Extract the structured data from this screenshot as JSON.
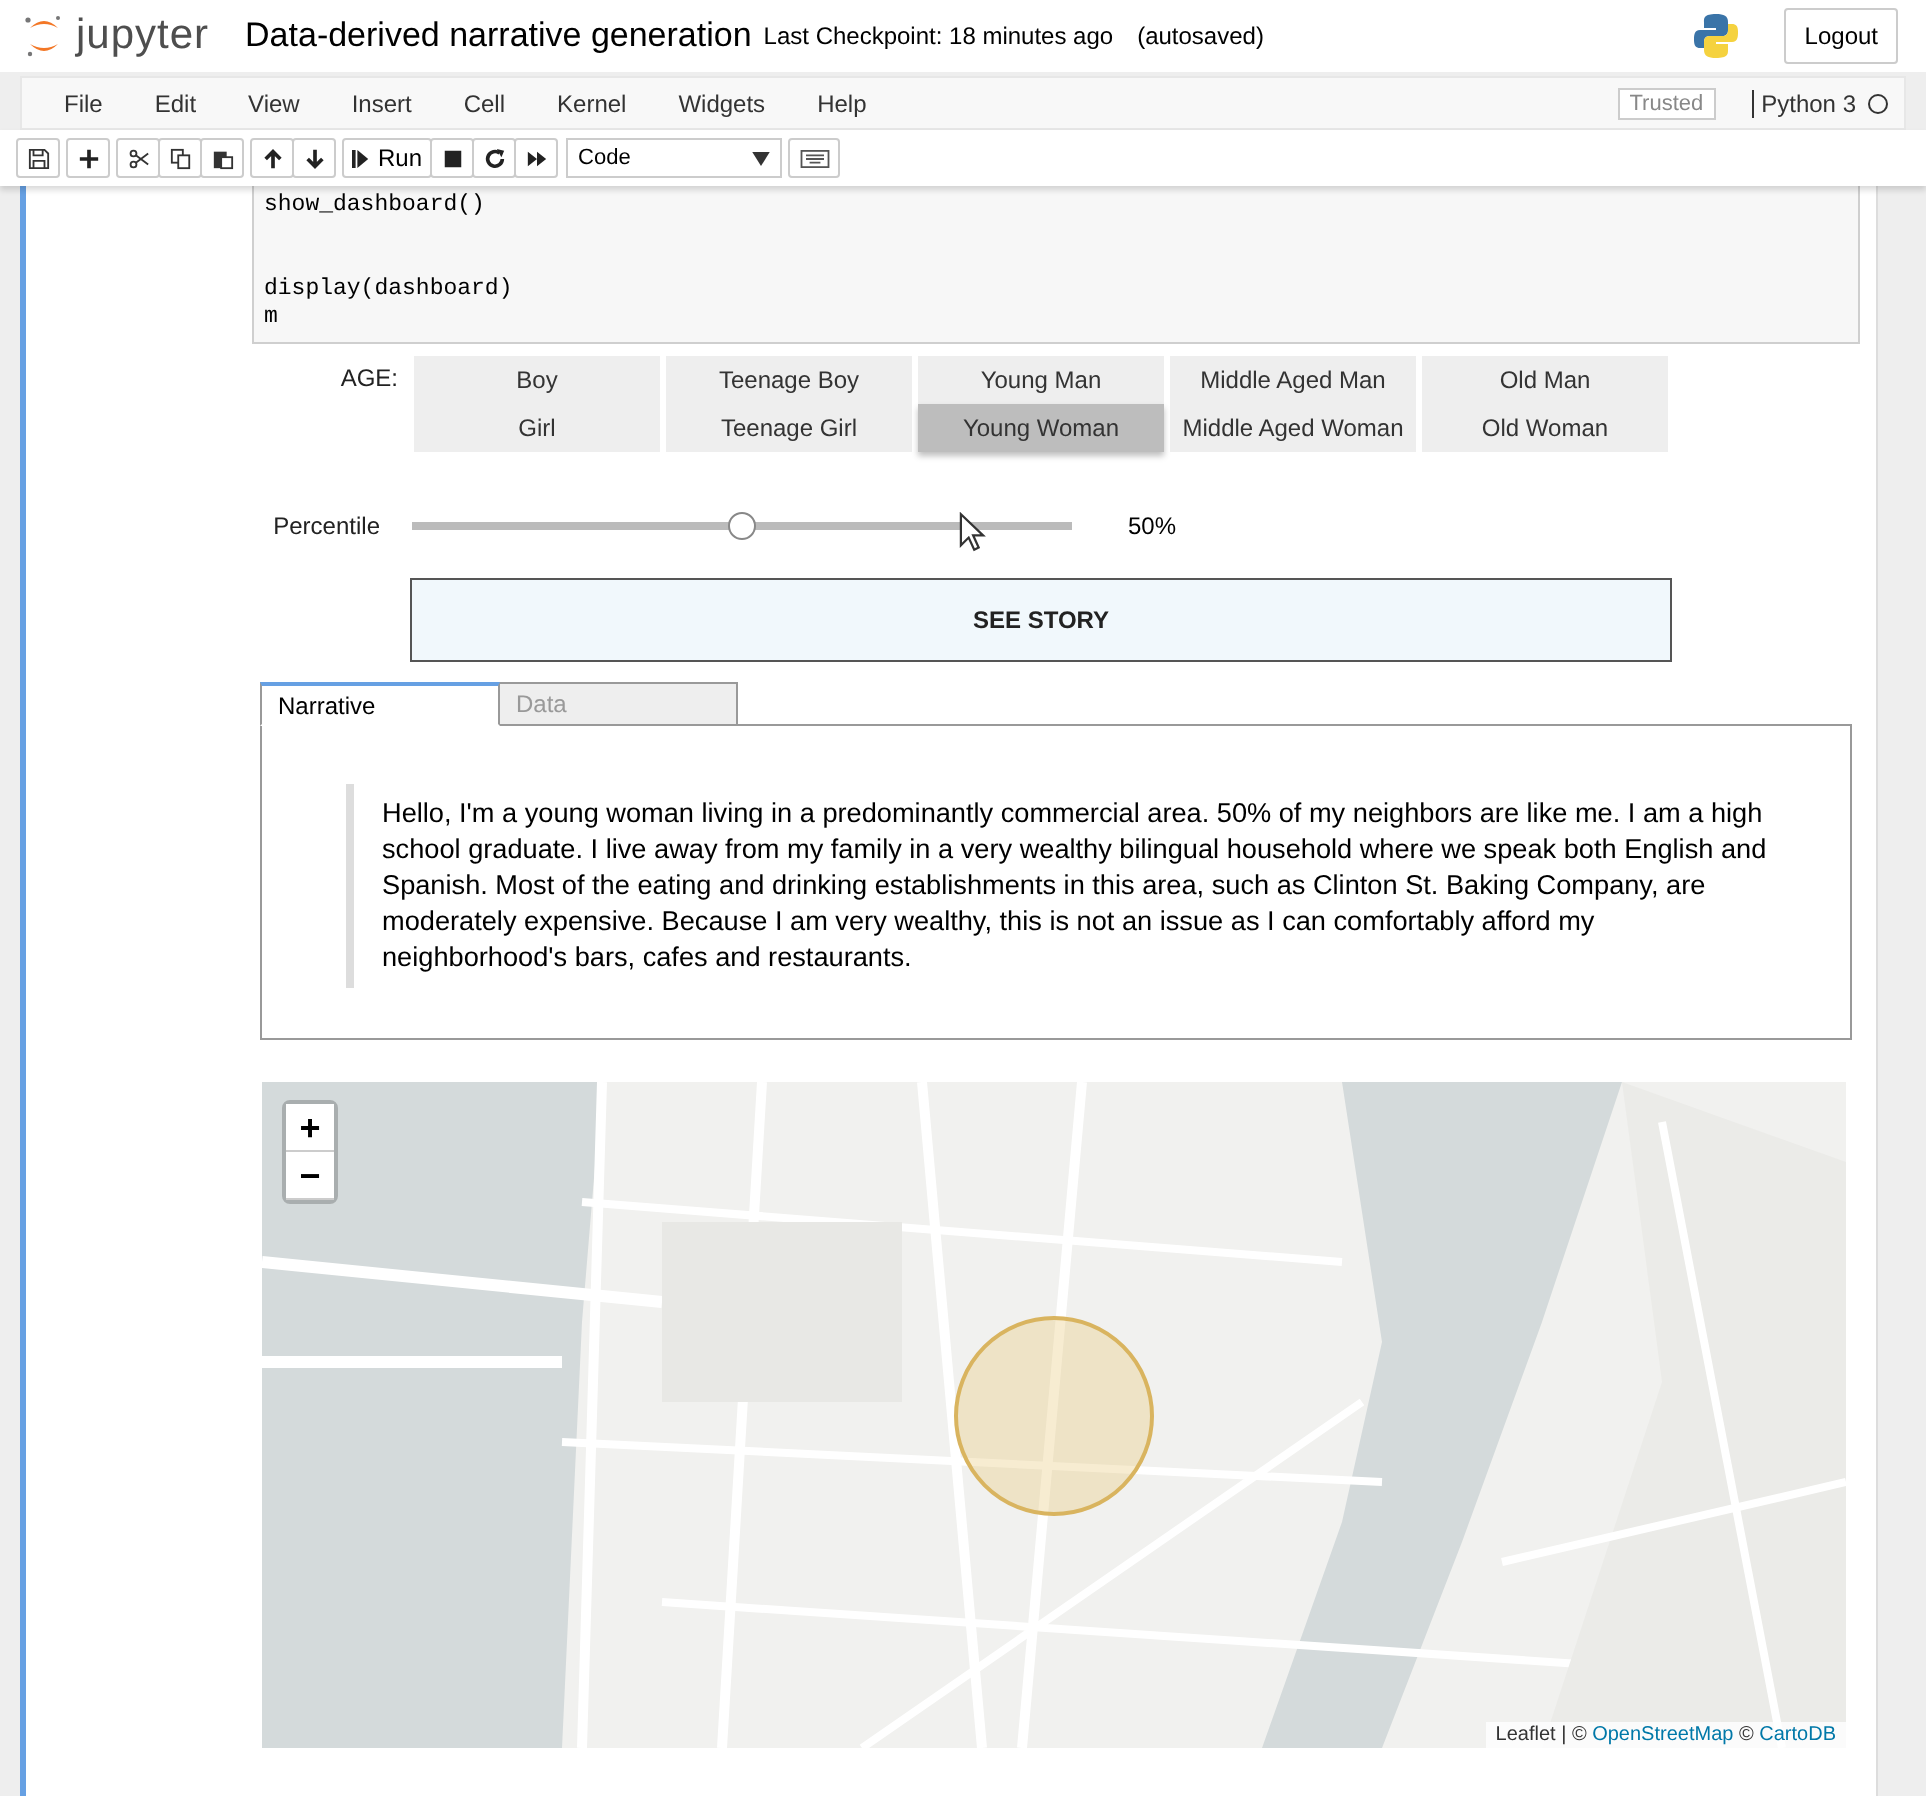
{
  "header": {
    "logo_text": "jupyter",
    "notebook_title": "Data-derived narrative generation",
    "checkpoint": "Last Checkpoint: 18 minutes ago",
    "autosave": "(autosaved)",
    "logout": "Logout"
  },
  "menu": {
    "items": [
      "File",
      "Edit",
      "View",
      "Insert",
      "Cell",
      "Kernel",
      "Widgets",
      "Help"
    ],
    "trusted": "Trusted",
    "kernel": "Python 3"
  },
  "toolbar": {
    "run": "Run",
    "cell_type": "Code"
  },
  "code": [
    {
      "lines": [
        "show_dashboard()"
      ]
    },
    {
      "lines": [
        "display(dashboard)",
        "m"
      ]
    }
  ],
  "age": {
    "label": "AGE:",
    "options": [
      {
        "label": "Boy",
        "selected": false
      },
      {
        "label": "Teenage Boy",
        "selected": false
      },
      {
        "label": "Young Man",
        "selected": false
      },
      {
        "label": "Middle Aged Man",
        "selected": false
      },
      {
        "label": "Old Man",
        "selected": false
      },
      {
        "label": "Girl",
        "selected": false
      },
      {
        "label": "Teenage Girl",
        "selected": false
      },
      {
        "label": "Young Woman",
        "selected": true
      },
      {
        "label": "Middle Aged Woman",
        "selected": false
      },
      {
        "label": "Old Woman",
        "selected": false
      }
    ]
  },
  "slider": {
    "label": "Percentile",
    "level": 0.5,
    "reading": "50%"
  },
  "story_button": "SEE STORY",
  "tabs": [
    {
      "label": "Narrative",
      "selected": true
    },
    {
      "label": "Data",
      "selected": false
    }
  ],
  "narrative": "Hello, I'm a young woman living in a predominantly commercial area. 50% of my neighbors are like me. I am a high school graduate. I live away from my family in a very wealthy bilingual household where we speak both English and Spanish. Most of the eating and drinking establishments in this area, such as Clinton St. Baking Company, are moderately expensive. Because I am very wealthy, this is not an issue as I can comfortably afford my neighborhood's bars, cafes and restaurants.",
  "map": {
    "kind": "picture",
    "zoom_in": "+",
    "zoom_out": "−",
    "attribution": [
      {
        "kind": "text",
        "text": "Leaflet | ©"
      },
      {
        "kind": "link",
        "text": "OpenStreetMap"
      },
      {
        "kind": "text",
        "text": "©"
      },
      {
        "kind": "link",
        "text": "CartoDB"
      }
    ]
  }
}
